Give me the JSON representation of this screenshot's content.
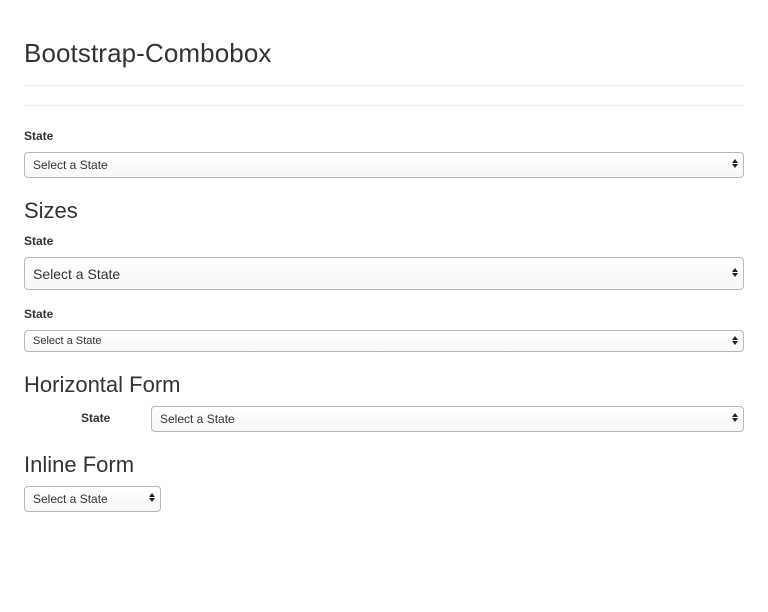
{
  "page": {
    "title": "Bootstrap-Combobox"
  },
  "basic": {
    "label": "State",
    "select_value": "Select a State"
  },
  "sizes": {
    "heading": "Sizes",
    "large": {
      "label": "State",
      "select_value": "Select a State"
    },
    "small": {
      "label": "State",
      "select_value": "Select a State"
    }
  },
  "horizontal": {
    "heading": "Horizontal Form",
    "label": "State",
    "select_value": "Select a State"
  },
  "inline": {
    "heading": "Inline Form",
    "select_value": "Select a State"
  },
  "icons": {
    "select_arrows": "up-down-caret-icon"
  }
}
